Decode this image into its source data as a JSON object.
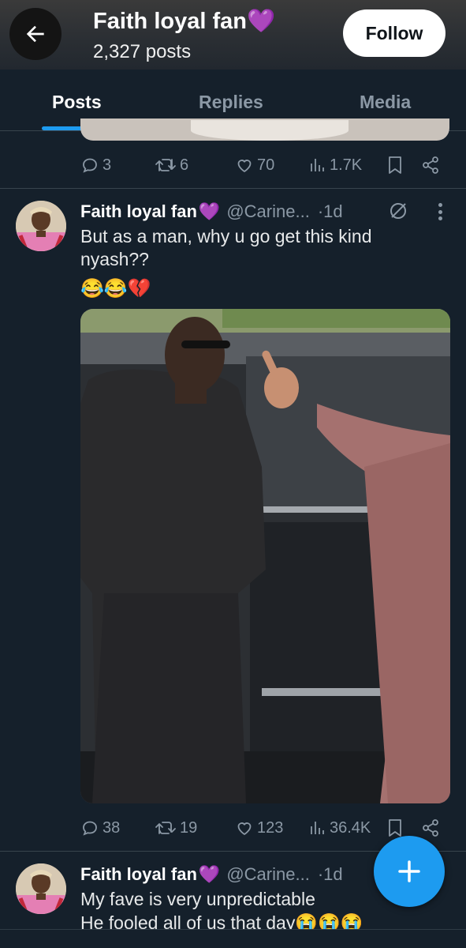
{
  "header": {
    "profile_name": "Faith loyal fan💜",
    "post_count": "2,327 posts",
    "follow_label": "Follow"
  },
  "tabs": [
    {
      "label": "Posts",
      "active": true
    },
    {
      "label": "Replies",
      "active": false
    },
    {
      "label": "Media",
      "active": false
    }
  ],
  "prev_tweet": {
    "replies": "3",
    "reposts": "6",
    "likes": "70",
    "views": "1.7K"
  },
  "tweet1": {
    "name": "Faith loyal fan",
    "heart": "💜",
    "handle": "@Carine...",
    "dot": "·",
    "time": "1d",
    "text": "But as a man, why u go get this kind nyash??",
    "emojis": "😂😂💔",
    "replies": "38",
    "reposts": "19",
    "likes": "123",
    "views": "36.4K"
  },
  "tweet2": {
    "name": "Faith loyal fan",
    "heart": "💜",
    "handle": "@Carine...",
    "dot": "·",
    "time": "1d",
    "line1": "My fave is very unpredictable",
    "line2": "He fooled all of us that day😭😭😭"
  },
  "colors": {
    "background": "#15202b",
    "accent": "#1d9bf0",
    "muted": "#8b98a5",
    "divider": "#38444d"
  }
}
